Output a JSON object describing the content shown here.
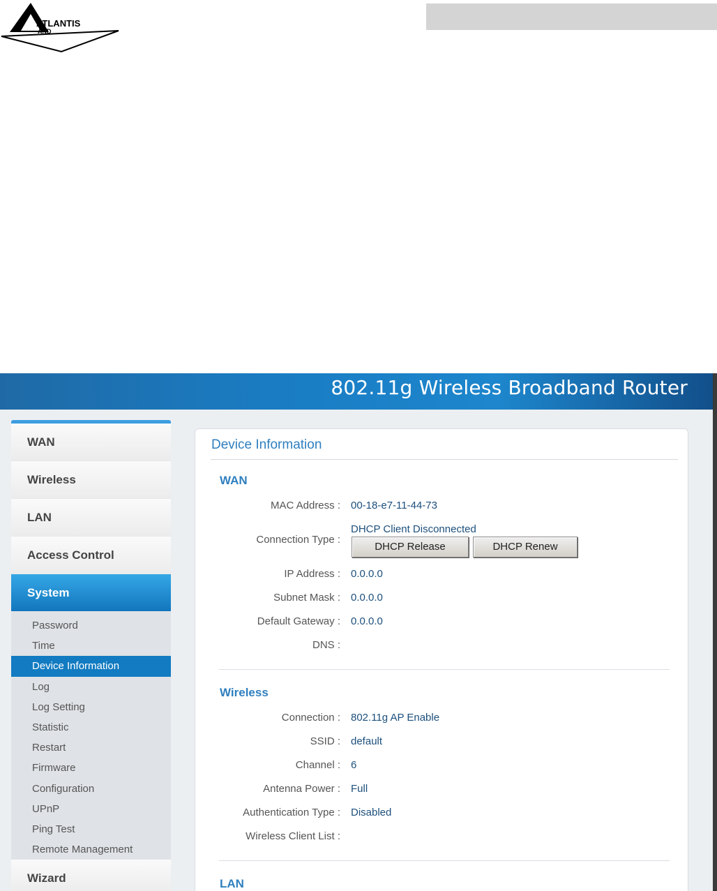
{
  "doc_header": {
    "logo_text": "ATLANTIS",
    "logo_subtext": "AND"
  },
  "banner": {
    "title": "802.11g Wireless Broadband Router"
  },
  "sidebar": {
    "menus_top": [
      {
        "label": "WAN"
      },
      {
        "label": "Wireless"
      },
      {
        "label": "LAN"
      },
      {
        "label": "Access Control"
      },
      {
        "label": "System"
      }
    ],
    "system_items": [
      {
        "label": "Password"
      },
      {
        "label": "Time"
      },
      {
        "label": "Device Information"
      },
      {
        "label": "Log"
      },
      {
        "label": "Log Setting"
      },
      {
        "label": "Statistic"
      },
      {
        "label": "Restart"
      },
      {
        "label": "Firmware"
      },
      {
        "label": "Configuration"
      },
      {
        "label": "UPnP"
      },
      {
        "label": "Ping Test"
      },
      {
        "label": "Remote Management"
      }
    ],
    "active_menu": "System",
    "active_item": "Device Information",
    "menu_bottom": {
      "label": "Wizard"
    }
  },
  "content": {
    "title": "Device Information",
    "wan": {
      "heading": "WAN",
      "mac_label": "MAC Address :",
      "mac_value": "00-18-e7-11-44-73",
      "conn_label": "Connection Type :",
      "conn_value": "DHCP Client Disconnected",
      "release_button": "DHCP Release",
      "renew_button": "DHCP Renew",
      "ip_label": "IP Address :",
      "ip_value": "0.0.0.0",
      "mask_label": "Subnet Mask :",
      "mask_value": "0.0.0.0",
      "gw_label": "Default Gateway :",
      "gw_value": "0.0.0.0",
      "dns_label": "DNS :",
      "dns_value": ""
    },
    "wireless": {
      "heading": "Wireless",
      "connection_label": "Connection :",
      "connection_value": "802.11g AP Enable",
      "ssid_label": "SSID :",
      "ssid_value": "default",
      "channel_label": "Channel :",
      "channel_value": "6",
      "antenna_label": "Antenna Power :",
      "antenna_value": "Full",
      "auth_label": "Authentication Type :",
      "auth_value": "Disabled",
      "clients_label": "Wireless Client List :",
      "clients_value": ""
    },
    "lan": {
      "heading": "LAN"
    }
  },
  "colors": {
    "accent": "#2f7fbf",
    "banner": "#1a7dc4",
    "active_menu": "#1e8bd0",
    "value_text": "#1c4f7c"
  }
}
